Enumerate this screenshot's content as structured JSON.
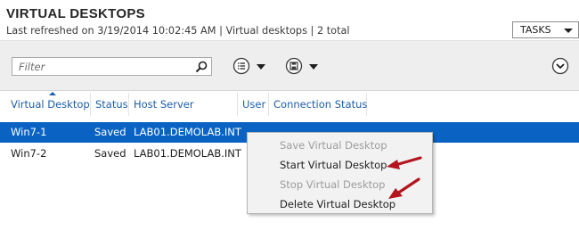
{
  "header": {
    "title": "VIRTUAL DESKTOPS",
    "subtitle": "Last refreshed on 3/19/2014 10:02:45 AM | Virtual desktops  | 2 total",
    "tasks_label": "TASKS"
  },
  "toolbar": {
    "filter_placeholder": "Filter",
    "icons": [
      "search-icon",
      "view-options-icon",
      "save-query-icon",
      "collapse-icon"
    ]
  },
  "grid": {
    "columns": [
      "Virtual Desktop",
      "Status",
      "Host Server",
      "User",
      "Connection Status"
    ],
    "sorted_column": "Virtual Desktop",
    "rows": [
      {
        "name": "Win7-1",
        "status": "Saved",
        "host": "LAB01.DEMOLAB.INT",
        "user": "",
        "connection": "",
        "selected": true
      },
      {
        "name": "Win7-2",
        "status": "Saved",
        "host": "LAB01.DEMOLAB.INT",
        "user": "",
        "connection": "",
        "selected": false
      }
    ]
  },
  "context_menu": {
    "items": [
      {
        "label": "Save Virtual Desktop",
        "enabled": false
      },
      {
        "label": "Start Virtual Desktop",
        "enabled": true
      },
      {
        "label": "Stop Virtual Desktop",
        "enabled": false
      },
      {
        "label": "Delete Virtual Desktop",
        "enabled": true
      }
    ]
  },
  "colors": {
    "selection": "#0a63c3",
    "header_link": "#1d5ea8",
    "annotation_arrow": "#b3141e",
    "toolbar_bg": "#eeeeee"
  }
}
